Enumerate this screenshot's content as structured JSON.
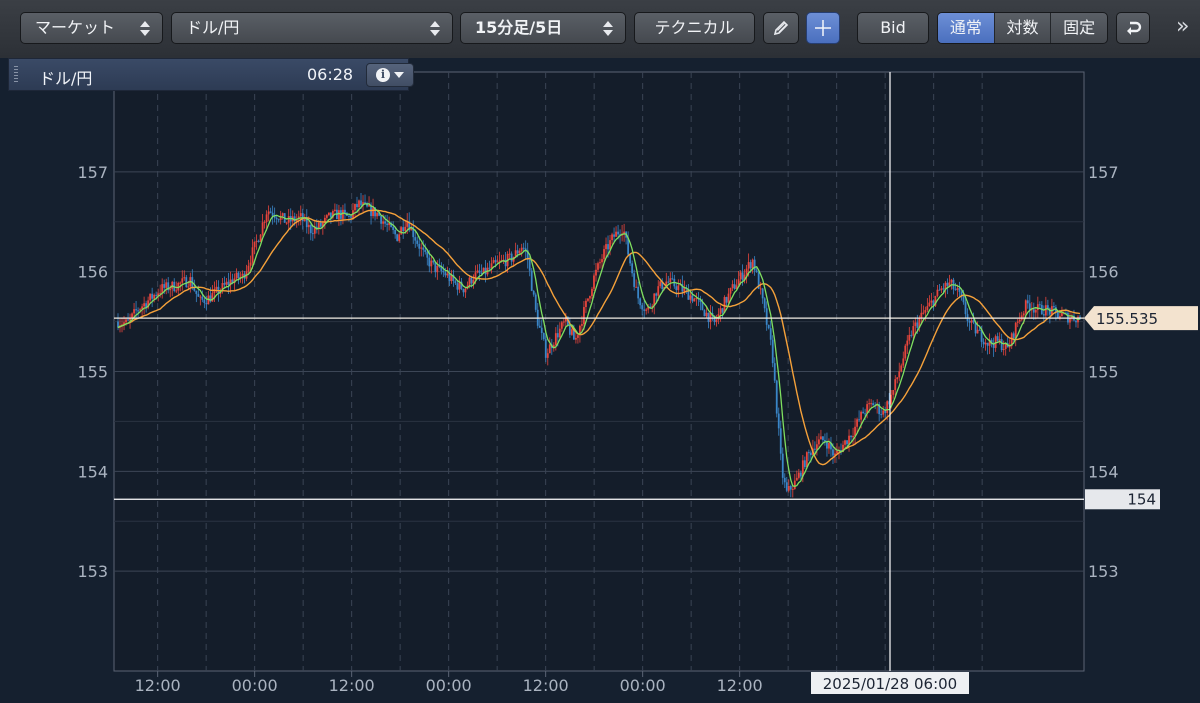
{
  "toolbar": {
    "market_select": "マーケット",
    "symbol_select": "ドル/円",
    "period_select": "15分足/5日",
    "technical_label": "テクニカル",
    "bid_label": "Bid",
    "scale_options": [
      "通常",
      "対数",
      "固定"
    ],
    "scale_selected": "通常",
    "icons": [
      "pencil-icon",
      "crosshair-icon",
      "undo-icon",
      "double-chevron-right-icon"
    ]
  },
  "info_panel": {
    "title": "ドル/円",
    "time": "06:28"
  },
  "colors": {
    "bg": "#15202f",
    "plot_bg": "#141d2a",
    "up": "#e8453c",
    "down": "#3a86c8",
    "ma_short": "#7fe060",
    "ma_long": "#f5a13a",
    "price_tag": "#f3e3cf",
    "cross_tag": "#e6e8ec"
  },
  "chart_data": {
    "type": "candlestick",
    "x_tick_labels": [
      "12:00",
      "00:00",
      "12:00",
      "00:00",
      "12:00",
      "00:00",
      "12:00",
      "00:00"
    ],
    "y_tick_labels": [
      "153",
      "154",
      "155",
      "156",
      "157"
    ],
    "y_ticks": [
      153,
      154,
      155,
      156,
      157
    ],
    "ylim": [
      152.0,
      158.0
    ],
    "grid": true,
    "current_price_label": "155.535",
    "current_price": 155.535,
    "crosshair": {
      "time_label": "2025/01/28 06:00",
      "price_label": "154",
      "price": 153.72,
      "x_fraction": 0.8
    },
    "price_path": [
      [
        0.0,
        155.5
      ],
      [
        0.01,
        155.48
      ],
      [
        0.02,
        155.62
      ],
      [
        0.03,
        155.7
      ],
      [
        0.045,
        155.83
      ],
      [
        0.06,
        155.86
      ],
      [
        0.075,
        155.92
      ],
      [
        0.085,
        155.7
      ],
      [
        0.095,
        155.74
      ],
      [
        0.11,
        155.85
      ],
      [
        0.12,
        155.93
      ],
      [
        0.13,
        155.95
      ],
      [
        0.145,
        156.32
      ],
      [
        0.155,
        156.62
      ],
      [
        0.165,
        156.57
      ],
      [
        0.175,
        156.5
      ],
      [
        0.19,
        156.54
      ],
      [
        0.2,
        156.42
      ],
      [
        0.21,
        156.45
      ],
      [
        0.22,
        156.55
      ],
      [
        0.23,
        156.58
      ],
      [
        0.24,
        156.54
      ],
      [
        0.25,
        156.68
      ],
      [
        0.26,
        156.62
      ],
      [
        0.27,
        156.58
      ],
      [
        0.28,
        156.45
      ],
      [
        0.29,
        156.35
      ],
      [
        0.3,
        156.53
      ],
      [
        0.31,
        156.32
      ],
      [
        0.32,
        156.13
      ],
      [
        0.33,
        156.03
      ],
      [
        0.34,
        155.98
      ],
      [
        0.35,
        155.88
      ],
      [
        0.36,
        155.83
      ],
      [
        0.37,
        155.96
      ],
      [
        0.38,
        155.98
      ],
      [
        0.39,
        156.06
      ],
      [
        0.4,
        156.1
      ],
      [
        0.41,
        156.14
      ],
      [
        0.42,
        156.26
      ],
      [
        0.425,
        156.18
      ],
      [
        0.435,
        155.55
      ],
      [
        0.445,
        155.18
      ],
      [
        0.455,
        155.35
      ],
      [
        0.465,
        155.5
      ],
      [
        0.475,
        155.3
      ],
      [
        0.485,
        155.62
      ],
      [
        0.495,
        155.95
      ],
      [
        0.505,
        156.18
      ],
      [
        0.515,
        156.35
      ],
      [
        0.525,
        156.45
      ],
      [
        0.53,
        156.2
      ],
      [
        0.54,
        155.75
      ],
      [
        0.55,
        155.6
      ],
      [
        0.56,
        155.82
      ],
      [
        0.57,
        155.9
      ],
      [
        0.58,
        155.86
      ],
      [
        0.59,
        155.8
      ],
      [
        0.6,
        155.72
      ],
      [
        0.61,
        155.6
      ],
      [
        0.62,
        155.48
      ],
      [
        0.63,
        155.68
      ],
      [
        0.64,
        155.85
      ],
      [
        0.65,
        155.98
      ],
      [
        0.66,
        156.12
      ],
      [
        0.67,
        155.7
      ],
      [
        0.68,
        155.2
      ],
      [
        0.685,
        154.6
      ],
      [
        0.69,
        154.0
      ],
      [
        0.695,
        153.78
      ],
      [
        0.705,
        153.9
      ],
      [
        0.715,
        154.12
      ],
      [
        0.725,
        154.28
      ],
      [
        0.735,
        154.32
      ],
      [
        0.745,
        154.15
      ],
      [
        0.755,
        154.28
      ],
      [
        0.765,
        154.42
      ],
      [
        0.775,
        154.6
      ],
      [
        0.785,
        154.68
      ],
      [
        0.795,
        154.58
      ],
      [
        0.805,
        154.78
      ],
      [
        0.815,
        155.1
      ],
      [
        0.825,
        155.4
      ],
      [
        0.835,
        155.55
      ],
      [
        0.845,
        155.68
      ],
      [
        0.855,
        155.82
      ],
      [
        0.865,
        155.88
      ],
      [
        0.875,
        155.76
      ],
      [
        0.885,
        155.48
      ],
      [
        0.895,
        155.38
      ],
      [
        0.905,
        155.28
      ],
      [
        0.915,
        155.3
      ],
      [
        0.925,
        155.22
      ],
      [
        0.935,
        155.5
      ],
      [
        0.945,
        155.68
      ],
      [
        0.955,
        155.62
      ],
      [
        0.965,
        155.62
      ],
      [
        0.975,
        155.58
      ],
      [
        0.985,
        155.55
      ],
      [
        1.0,
        155.535
      ]
    ]
  }
}
